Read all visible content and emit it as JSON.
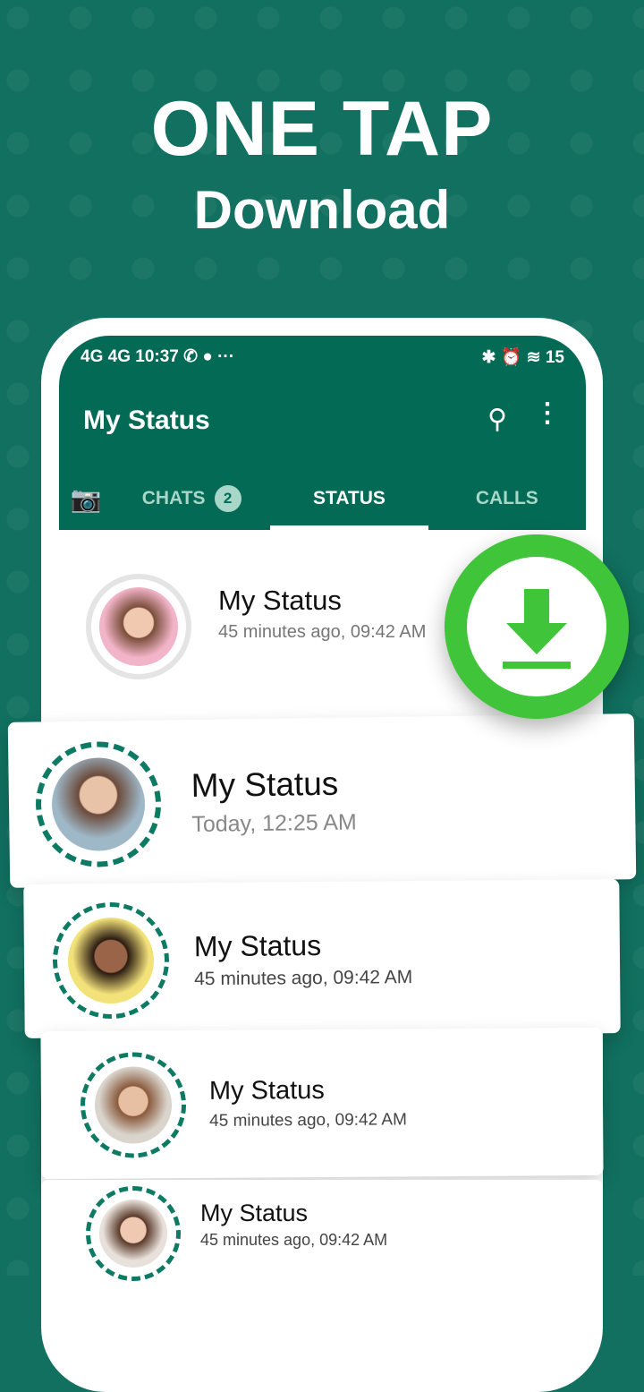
{
  "promo": {
    "headline": "ONE TAP",
    "subheadline": "Download"
  },
  "status_bar": {
    "left": "4G 4G 10:37 ✆ ● ···",
    "right": "✱ ⏰ ≋ 15"
  },
  "app": {
    "title": "My Status",
    "tabs": [
      {
        "label": "CHATS",
        "badge": "2"
      },
      {
        "label": "STATUS"
      },
      {
        "label": "CALLS"
      }
    ]
  },
  "statuses": [
    {
      "name": "My Status",
      "time": "45 minutes ago, 09:42 AM"
    },
    {
      "name": "My Status",
      "time": "Today, 12:25 AM"
    },
    {
      "name": "My Status",
      "time": "45 minutes ago, 09:42 AM"
    },
    {
      "name": "My Status",
      "time": "45 minutes ago, 09:42 AM"
    },
    {
      "name": "My Status",
      "time": "45 minutes ago, 09:42 AM"
    }
  ],
  "colors": {
    "background": "#11705f",
    "header": "#036b55",
    "download": "#3fc43a",
    "ring": "#0d7a63"
  }
}
